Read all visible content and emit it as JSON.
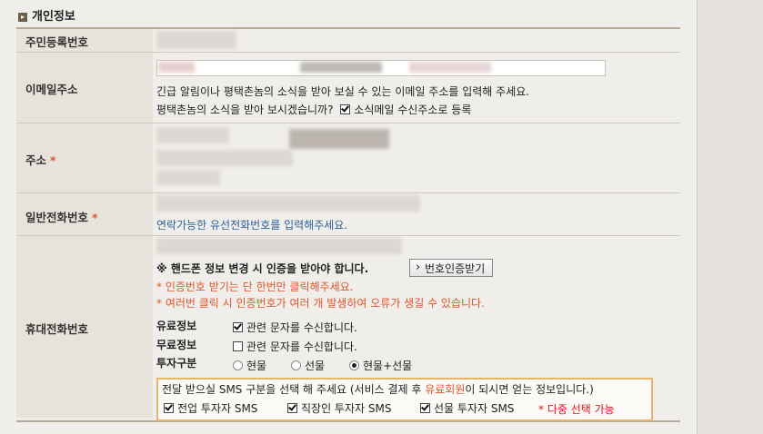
{
  "section": {
    "title": "개인정보"
  },
  "rows": {
    "resident": {
      "label": "주민등록번호"
    },
    "email": {
      "label": "이메일주소",
      "help": "긴급 알림이나 평택촌놈의 소식을 받아 보실 수 있는 이메일 주소를 입력해 주세요.",
      "subscribe_question": "평택촌놈의 소식을 받아 보시겠습니까?",
      "subscribe_checkbox": "소식메일 수신주소로 등록"
    },
    "address": {
      "label": "주소",
      "required_mark": "*"
    },
    "phone": {
      "label": "일반전화번호",
      "required_mark": "*",
      "help": "연락가능한 유선전화번호를 입력해주세요."
    },
    "mobile": {
      "label": "휴대전화번호",
      "notice": "※ 핸드폰 정보 변경 시 인증을 받아야 합니다.",
      "verify_button": "번호인증받기",
      "warn1": "* 인증번호 받기는 단 한번만 클릭해주세요.",
      "warn2": "* 여러번 클릭 시 인증번호가 여러 개 발생하여 오류가 생길 수 있습니다.",
      "paid_label": "유료정보",
      "paid_option": "관련 문자를 수신합니다.",
      "free_label": "무료정보",
      "free_option": "관련 문자를 수신합니다.",
      "investor_label": "투자구분",
      "investor_options": [
        "현물",
        "선물",
        "현물+선물"
      ],
      "sms_box": {
        "text_before": "전달 받으실 SMS 구분을 선택 해 주세요 (서비스 결제 후 ",
        "text_highlight": "유료회원",
        "text_after": "이 되시면 얻는 정보입니다.)",
        "options": [
          "전업 투자자 SMS",
          "직장인 투자자 SMS",
          "선물 투자자 SMS"
        ],
        "multi_note": "* 다중 선택 가능"
      }
    }
  }
}
